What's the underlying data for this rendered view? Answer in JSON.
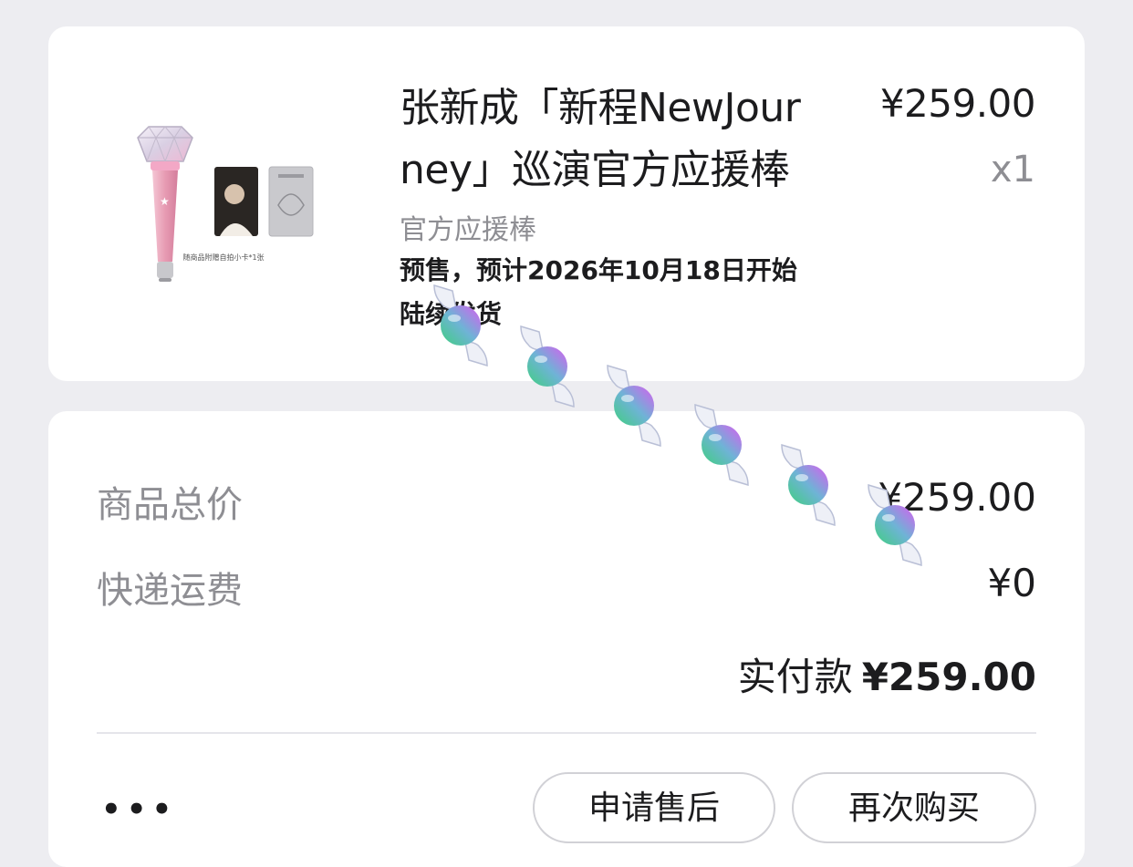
{
  "product": {
    "title": "张新成「新程NewJourney」巡演官方应援棒",
    "price": "¥259.00",
    "quantity": "x1",
    "variant": "官方应援棒",
    "presale_note": "预售，预计2026年10月18日开始陆续发货",
    "image_caption": "随商品附赠自拍小卡*1张"
  },
  "summary": {
    "goods_total_label": "商品总价",
    "goods_total_value": "¥259.00",
    "shipping_label": "快递运费",
    "shipping_value": "¥0",
    "paid_label": "实付款",
    "paid_value": "¥259.00"
  },
  "actions": {
    "more_label": "•••",
    "after_sale_label": "申请售后",
    "rebuy_label": "再次购买"
  },
  "colors": {
    "background": "#ededf1",
    "card": "#ffffff",
    "muted_text": "#8e8e93"
  }
}
